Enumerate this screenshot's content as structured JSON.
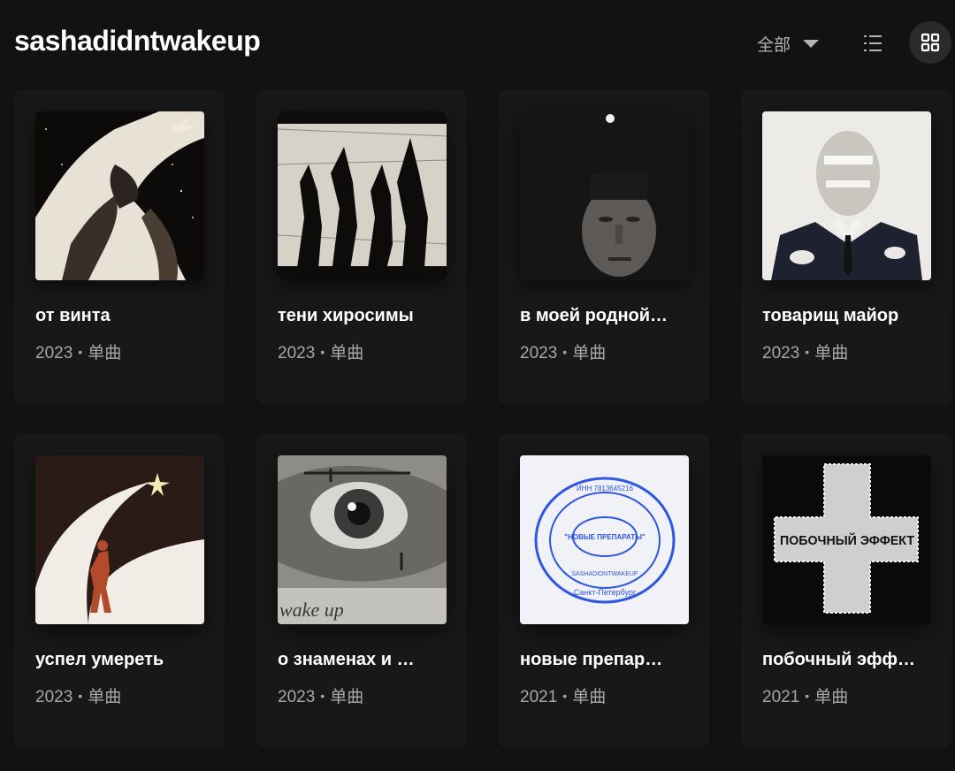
{
  "artist": {
    "name": "sashadidntwakeup"
  },
  "toolbar": {
    "filter_label": "全部",
    "filter_icon": "caret-down-icon",
    "list_view_icon": "list-view-icon",
    "grid_view_icon": "grid-view-icon"
  },
  "releases": [
    {
      "title": "от винта",
      "year": "2023",
      "type": "单曲",
      "art": "statue-rocket"
    },
    {
      "title": "тени хиросимы",
      "year": "2023",
      "type": "单曲",
      "art": "dancing-shadows"
    },
    {
      "title": "в моей родной…",
      "year": "2023",
      "type": "单曲",
      "art": "dark-portrait"
    },
    {
      "title": "товарищ майор",
      "year": "2023",
      "type": "单曲",
      "art": "officer-photo"
    },
    {
      "title": "успел умереть",
      "year": "2023",
      "type": "单曲",
      "art": "figure-star-path"
    },
    {
      "title": "о знаменах и …",
      "year": "2023",
      "type": "单曲",
      "art": "eye-closeup"
    },
    {
      "title": "новые препар…",
      "year": "2021",
      "type": "单曲",
      "art": "blue-stamp"
    },
    {
      "title": "побочный эфф…",
      "year": "2021",
      "type": "单曲",
      "art": "cross-logo"
    }
  ],
  "art_text": {
    "stamp_center": "\"НОВЫЕ ПРЕПАРАТЫ\"",
    "stamp_inn": "ИНН 7813645216",
    "stamp_city": "Санкт-Петербург",
    "stamp_name": "SASHADIDNTWAKEUP",
    "eye_tattoo": "wake up",
    "cross_text": "ПОБОЧНЫЙ ЭФФЕКТ"
  }
}
